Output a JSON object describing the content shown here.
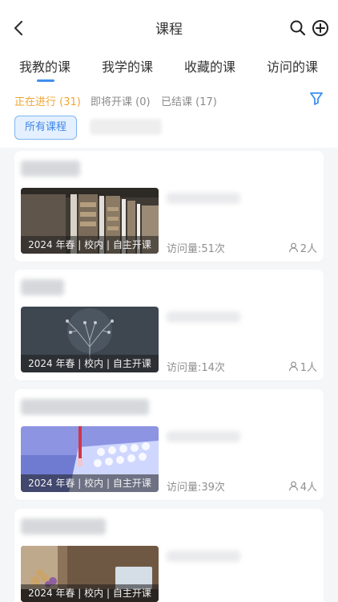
{
  "header": {
    "title": "课程"
  },
  "tabs": [
    {
      "label": "我教的课",
      "active": true
    },
    {
      "label": "我学的课",
      "active": false
    },
    {
      "label": "收藏的课",
      "active": false
    },
    {
      "label": "访问的课",
      "active": false
    }
  ],
  "status_filters": [
    {
      "label": "正在进行 (31)",
      "active": true
    },
    {
      "label": "即将开课 (0)",
      "active": false
    },
    {
      "label": "已结课 (17)",
      "active": false
    }
  ],
  "category_chip": "所有课程",
  "courses": [
    {
      "caption": "2024 年春 | 校内 | 自主开课",
      "visits": "访问量:51次",
      "people": "2人",
      "image": "library-shelves"
    },
    {
      "caption": "2024 年春 | 校内 | 自主开课",
      "visits": "访问量:14次",
      "people": "1人",
      "image": "network-tree"
    },
    {
      "caption": "2024 年春 | 校内 | 自主开课",
      "visits": "访问量:39次",
      "people": "4人",
      "image": "lab-pipette"
    },
    {
      "caption": "2024 年春 | 校内 | 自主开课",
      "visits": "",
      "people": "",
      "image": "laptop-room"
    }
  ],
  "colors": {
    "accent": "#3f8ef0",
    "active_status": "#f1a534",
    "caption_bg": "#1e1e1e"
  },
  "icons": [
    "back-arrow-icon",
    "search-icon",
    "add-circle-icon",
    "filter-icon",
    "person-icon"
  ]
}
